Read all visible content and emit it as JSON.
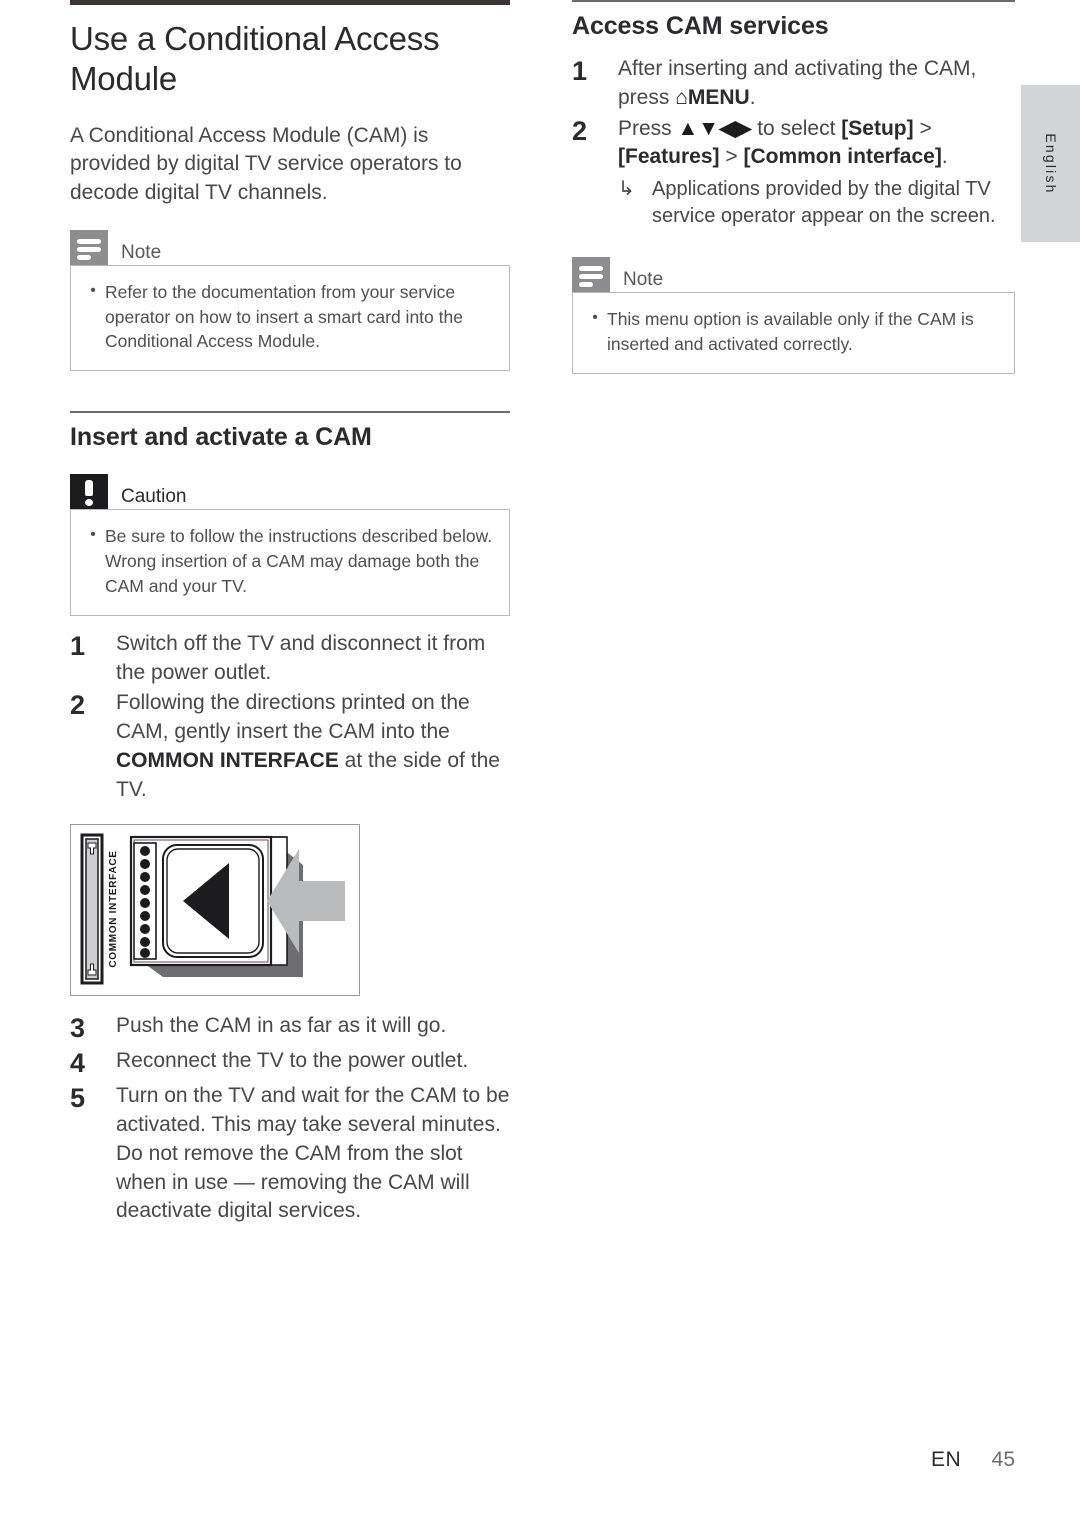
{
  "language_tab": {
    "label": "English"
  },
  "left_column": {
    "title": "Use a Conditional Access Module",
    "intro": "A Conditional Access Module (CAM) is provided by digital TV service operators to decode digital TV channels.",
    "note": {
      "label": "Note",
      "icon": "note-lines-icon",
      "items": [
        "Refer to the documentation from your service operator on how to insert a smart card into the Conditional Access Module."
      ]
    },
    "section_heading": "Insert and activate a CAM",
    "caution": {
      "label": "Caution",
      "icon": "exclamation-icon",
      "items": [
        "Be sure to follow the instructions described below. Wrong insertion of a CAM may damage both the CAM and your TV."
      ]
    },
    "steps_before_figure": [
      {
        "number": "1",
        "text": "Switch off the TV and disconnect it from the power outlet."
      },
      {
        "number": "2",
        "pre": "Following the directions printed on the CAM, gently insert the CAM into the ",
        "bold": "COMMON INTERFACE",
        "post": " at the side of the TV."
      }
    ],
    "figure": {
      "name": "cam-insertion-diagram",
      "slot_label": "COMMON INTERFACE",
      "arrow_direction": "left"
    },
    "steps_after_figure": [
      {
        "number": "3",
        "text": "Push the CAM in as far as it will go."
      },
      {
        "number": "4",
        "text": "Reconnect the TV to the power outlet."
      },
      {
        "number": "5",
        "text": "Turn on the TV and wait for the CAM to be activated. This may take several minutes. Do not remove the CAM from the slot when in use — removing the CAM will deactivate digital services."
      }
    ]
  },
  "right_column": {
    "section_heading": "Access CAM services",
    "steps": [
      {
        "number": "1",
        "pre": "After inserting and activating the CAM, press ",
        "glyph": "⌂",
        "bold": "MENU",
        "post": "."
      },
      {
        "number": "2",
        "pre": "Press ",
        "glyph": "▲▼◀▶",
        "mid": " to select ",
        "bold1": "[Setup]",
        "sep1": " > ",
        "bold2": "[Features]",
        "sep2": " > ",
        "bold3": "[Common interface]",
        "post": "."
      }
    ],
    "substep": {
      "arrow": "↳",
      "text": "Applications provided by the digital TV service operator appear on the screen."
    },
    "note": {
      "label": "Note",
      "icon": "note-lines-icon",
      "items": [
        "This menu option is available only if the CAM is inserted and activated correctly."
      ]
    }
  },
  "footer": {
    "locale_code": "EN",
    "page_number": "45"
  },
  "colors": {
    "note_icon_bg": "#8d8d8f",
    "caution_icon_bg": "#1c1c1e",
    "tab_bg": "#d2d4d6",
    "rule_dark": "#3a3433",
    "rule_thin": "#6b6b6d",
    "body_text": "#48484a"
  }
}
